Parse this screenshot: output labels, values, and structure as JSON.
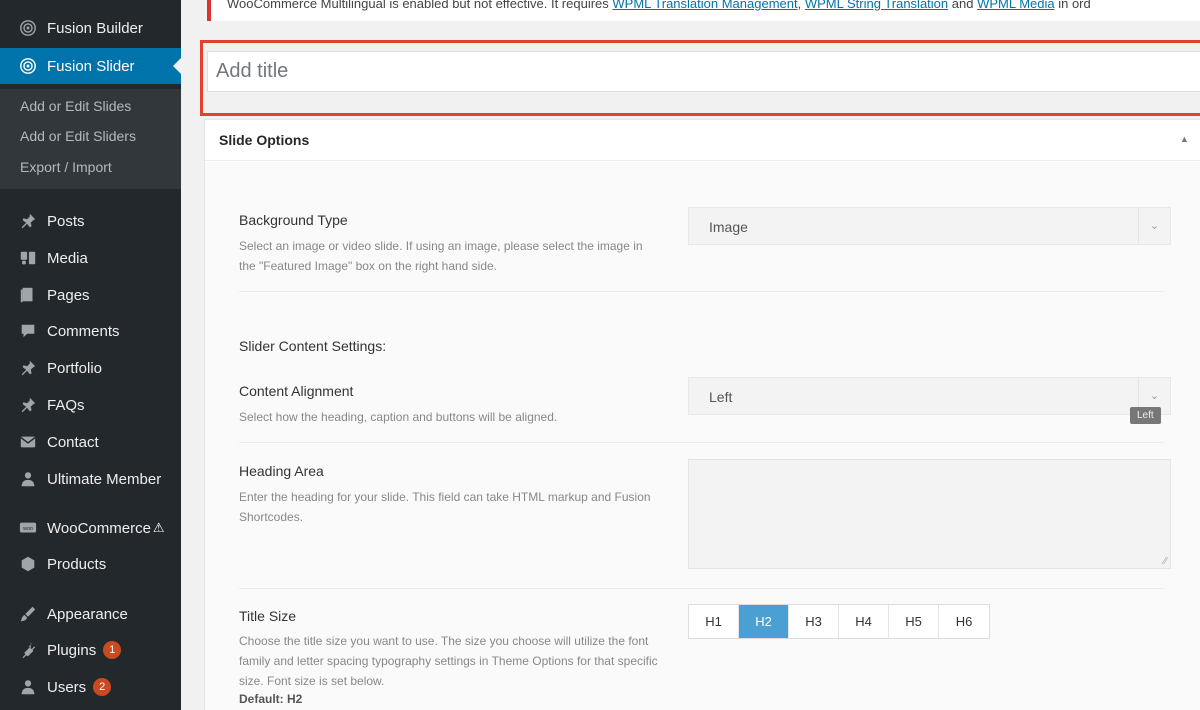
{
  "sidebar": {
    "fusion_builder": "Fusion Builder",
    "fusion_slider": "Fusion Slider",
    "submenu": [
      "Add or Edit Slides",
      "Add or Edit Sliders",
      "Export / Import"
    ],
    "items": [
      {
        "label": "Posts",
        "icon": "pin-icon"
      },
      {
        "label": "Media",
        "icon": "media-icon"
      },
      {
        "label": "Pages",
        "icon": "pages-icon"
      },
      {
        "label": "Comments",
        "icon": "comment-icon"
      },
      {
        "label": "Portfolio",
        "icon": "pin-icon"
      },
      {
        "label": "FAQs",
        "icon": "pin-icon"
      },
      {
        "label": "Contact",
        "icon": "mail-icon"
      },
      {
        "label": "Ultimate Member",
        "icon": "user-icon"
      },
      {
        "label": "WooCommerce",
        "icon": "woo-icon",
        "warn": "⚠"
      },
      {
        "label": "Products",
        "icon": "box-icon"
      },
      {
        "label": "Appearance",
        "icon": "brush-icon"
      },
      {
        "label": "Plugins",
        "icon": "plug-icon",
        "badge": "1"
      },
      {
        "label": "Users",
        "icon": "user-icon",
        "badge": "2"
      }
    ]
  },
  "notice": {
    "text_start": "WooCommerce Multilingual is enabled but not effective. It requires ",
    "link1": "WPML Translation Management",
    "sep1": ", ",
    "link2": "WPML String Translation",
    "sep2": " and ",
    "link3": "WPML Media",
    "text_end": " in ord"
  },
  "title_input": {
    "placeholder": "Add title"
  },
  "metabox": {
    "title": "Slide Options",
    "collapse_icon": "▲"
  },
  "options": {
    "background_type": {
      "label": "Background Type",
      "desc": "Select an image or video slide. If using an image, please select the image in the \"Featured Image\" box on the right hand side.",
      "value": "Image"
    },
    "slider_content_heading": "Slider Content Settings:",
    "content_alignment": {
      "label": "Content Alignment",
      "desc": "Select how the heading, caption and buttons will be aligned.",
      "value": "Left",
      "tooltip": "Left"
    },
    "heading_area": {
      "label": "Heading Area",
      "desc": "Enter the heading for your slide. This field can take HTML markup and Fusion Shortcodes."
    },
    "title_size": {
      "label": "Title Size",
      "desc": "Choose the title size you want to use. The size you choose will utilize the font family and letter spacing typography settings in Theme Options for that specific size. Font size is set below.",
      "default": "Default: H2",
      "buttons": [
        "H1",
        "H2",
        "H3",
        "H4",
        "H5",
        "H6"
      ],
      "selected": "H2"
    }
  },
  "colors": {
    "sidebar_bg": "#23282d",
    "accent": "#0073aa",
    "highlight_border": "#e2412d",
    "active_button": "#4a9fd3"
  }
}
